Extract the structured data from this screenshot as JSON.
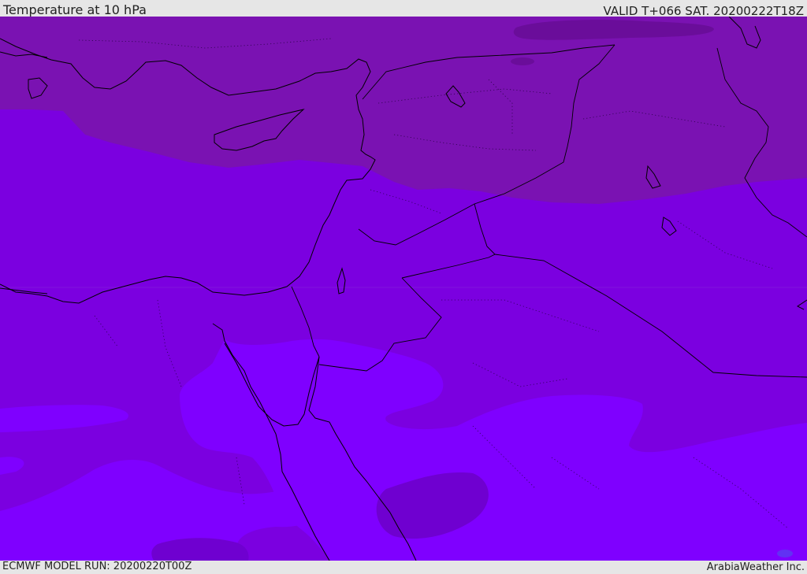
{
  "header": {
    "title": "Temperature at 10 hPa",
    "valid_time": "VALID T+066 SAT. 20200222T18Z"
  },
  "footer": {
    "model_run": "ECMWF MODEL RUN: 20200220T00Z",
    "credit": "ArabiaWeather Inc."
  },
  "map": {
    "region": "Eastern Mediterranean / Middle East",
    "fill_colors": {
      "coldest": "#6a0d9a",
      "cold": "#7a12b2",
      "mid": "#7b00e0",
      "warm": "#7f00ff",
      "warm_patch": "#6f00d0"
    }
  }
}
